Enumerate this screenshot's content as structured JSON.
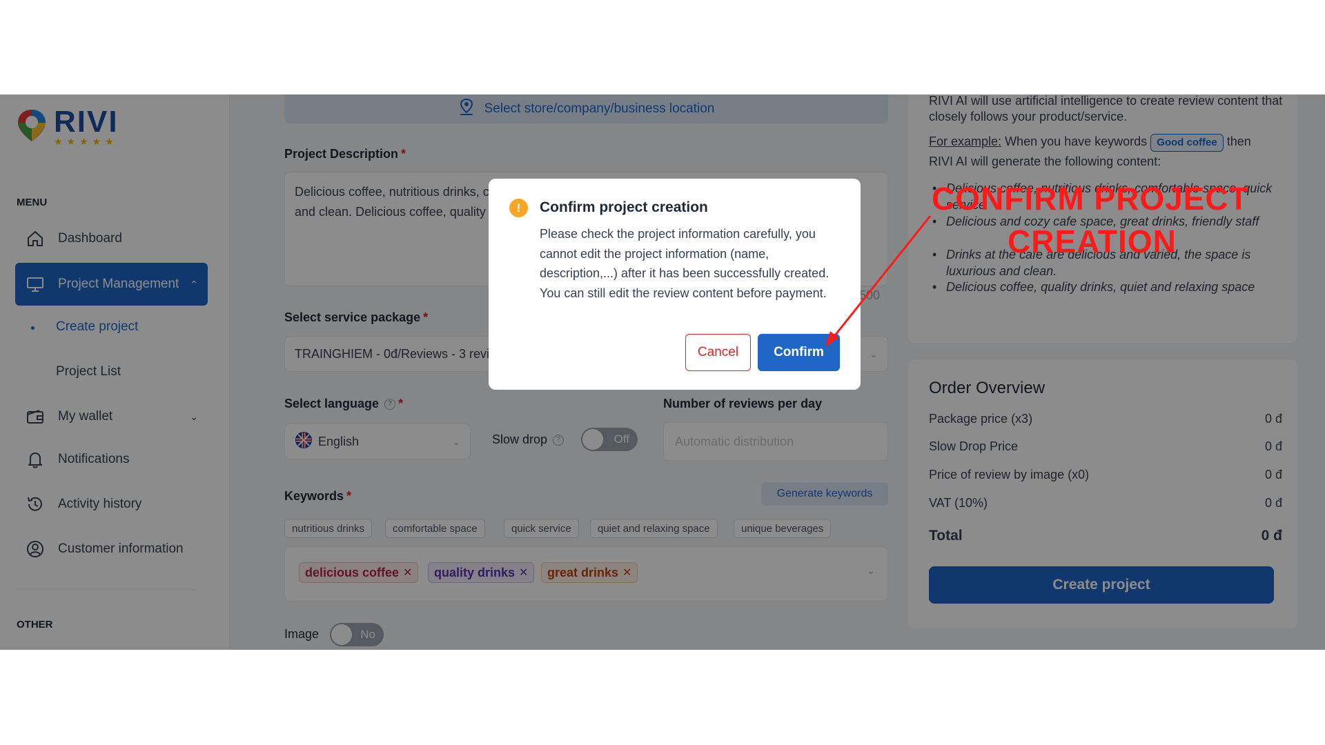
{
  "sidebar": {
    "logo_text": "RIVI",
    "menu_label": "MENU",
    "other_label": "OTHER",
    "items": [
      {
        "label": "Dashboard"
      },
      {
        "label": "Project Management"
      },
      {
        "label": "My wallet"
      },
      {
        "label": "Notifications"
      },
      {
        "label": "Activity history"
      },
      {
        "label": "Customer information"
      }
    ],
    "sub_items": [
      {
        "label": "Create project"
      },
      {
        "label": "Project List"
      }
    ]
  },
  "form": {
    "location_button": "Select store/company/business location",
    "description_label": "Project Description",
    "description_value": "Delicious coffee, nutritious drinks, comfortable space, great drinks, friendly staff, the space is luxurious and clean. Delicious coffee, quality drinks",
    "description_counter": "500",
    "package_label": "Select service package",
    "package_value": "TRAINGHIEM - 0đ/Reviews - 3 reviews",
    "language_label": "Select language",
    "language_value": "English",
    "slow_drop_label": "Slow drop",
    "slow_drop_state": "Off",
    "reviews_per_day_label": "Number of reviews per day",
    "reviews_per_day_placeholder": "Automatic distribution",
    "keywords_label": "Keywords",
    "generate_keywords": "Generate keywords",
    "suggested_keywords": [
      "nutritious drinks",
      "comfortable space",
      "quick service",
      "quiet and relaxing space",
      "unique beverages"
    ],
    "selected_keywords": [
      "delicious coffee",
      "quality drinks",
      "great drinks"
    ],
    "image_label": "Image",
    "image_state": "No"
  },
  "right_panel": {
    "intro": "RIVI AI will use artificial intelligence to create review content that closely follows your product/service.",
    "example_label": "For example:",
    "example_text_1": "When you have keywords",
    "example_keyword": "Good coffee",
    "example_text_2": "then",
    "example_text_3": "RIVI AI will generate the following content:",
    "bullets": [
      "Delicious coffee, nutritious drinks, comfortable space, quick service",
      "Delicious and cozy cafe space, great drinks, friendly staff",
      "Drinks at the cafe are delicious and varied, the space is luxurious and clean.",
      "Delicious coffee, quality drinks, quiet and relaxing space"
    ],
    "order_overview": {
      "title": "Order Overview",
      "rows": [
        {
          "label": "Package price (x3)",
          "value": "0 đ"
        },
        {
          "label": "Slow Drop Price",
          "value": "0 đ"
        },
        {
          "label": "Price of review by image (x0)",
          "value": "0 đ"
        },
        {
          "label": "VAT (10%)",
          "value": "0 đ"
        }
      ],
      "total_label": "Total",
      "total_value": "0 đ",
      "create_button": "Create project"
    }
  },
  "dialog": {
    "title": "Confirm project creation",
    "body": "Please check the project information carefully, you cannot edit the project information (name, description,...) after it has been successfully created. You can still edit the review content before payment.",
    "cancel": "Cancel",
    "confirm": "Confirm"
  },
  "annotation": {
    "line1": "CONFIRM PROJECT",
    "line2": "CREATION",
    "color": "#ff1a1a"
  },
  "colors": {
    "primary": "#1f66c7",
    "danger": "#dc2626",
    "warning": "#f5a623"
  }
}
